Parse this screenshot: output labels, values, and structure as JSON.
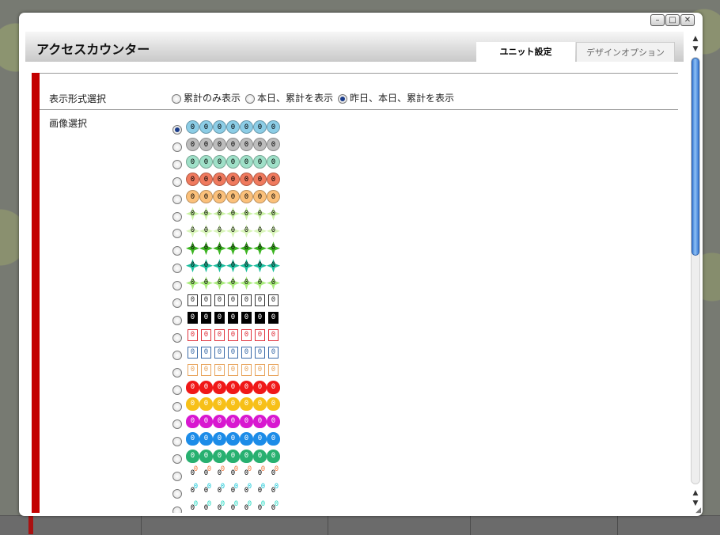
{
  "window": {
    "controls": [
      {
        "name": "minimize-button",
        "icon": "minimize-icon",
        "glyph": "–"
      },
      {
        "name": "maximize-button",
        "icon": "maximize-icon",
        "glyph": "□"
      },
      {
        "name": "close-button",
        "icon": "close-icon",
        "glyph": "✕"
      }
    ]
  },
  "header": {
    "title": "アクセスカウンター",
    "tabs": [
      {
        "label": "ユニット設定",
        "active": true
      },
      {
        "label": "デザインオプション",
        "active": false
      }
    ]
  },
  "form": {
    "format": {
      "label": "表示形式選択",
      "options": [
        {
          "label": "累計のみ表示",
          "selected": false
        },
        {
          "label": "本日、累計を表示",
          "selected": false
        },
        {
          "label": "昨日、本日、累計を表示",
          "selected": true
        }
      ]
    },
    "image": {
      "label": "画像選択",
      "digit_glyph": "0",
      "skins": [
        {
          "style": "circle",
          "color": "#8ccde6",
          "selected": true
        },
        {
          "style": "circle",
          "color": "#bdbdbd",
          "selected": false
        },
        {
          "style": "circle",
          "color": "#9fe0c8",
          "selected": false
        },
        {
          "style": "circle",
          "color": "#f07a5e",
          "selected": false
        },
        {
          "style": "circle",
          "color": "#fbc07a",
          "selected": false
        },
        {
          "style": "flower",
          "color": "#c9f2a2",
          "selected": false
        },
        {
          "style": "flower",
          "color": "#d8f5b8",
          "selected": false
        },
        {
          "style": "flower",
          "color": "#3cb521",
          "selected": false
        },
        {
          "style": "flower",
          "color": "#1dbf9f",
          "selected": false
        },
        {
          "style": "flower",
          "color": "#a9ec7c",
          "selected": false
        },
        {
          "style": "rect",
          "color": "#333333",
          "fill": "#ffffff",
          "selected": false
        },
        {
          "style": "rect",
          "color": "#000000",
          "fill": "#000000",
          "selected": false
        },
        {
          "style": "rect",
          "color": "#e0323c",
          "fill": "#ffffff",
          "selected": false
        },
        {
          "style": "rect",
          "color": "#3a6aa8",
          "fill": "#ffffff",
          "selected": false
        },
        {
          "style": "rect",
          "color": "#e8a45c",
          "fill": "#ffffff",
          "selected": false
        },
        {
          "style": "heart",
          "color": "#f01818",
          "selected": false
        },
        {
          "style": "heart",
          "color": "#f7c018",
          "selected": false
        },
        {
          "style": "heart",
          "color": "#d818d0",
          "selected": false
        },
        {
          "style": "heart",
          "color": "#1c8ce8",
          "selected": false
        },
        {
          "style": "heart",
          "color": "#28b070",
          "selected": false
        },
        {
          "style": "star",
          "color": "#f07a40",
          "selected": false
        },
        {
          "style": "star",
          "color": "#18c8d8",
          "selected": false
        },
        {
          "style": "star",
          "color": "#20d8c0",
          "selected": false
        },
        {
          "style": "star",
          "color": "#e020e0",
          "selected": false
        }
      ]
    }
  },
  "scrollbar": {
    "up_icon": "arrow-up-icon",
    "down_icon": "arrow-down-icon"
  }
}
